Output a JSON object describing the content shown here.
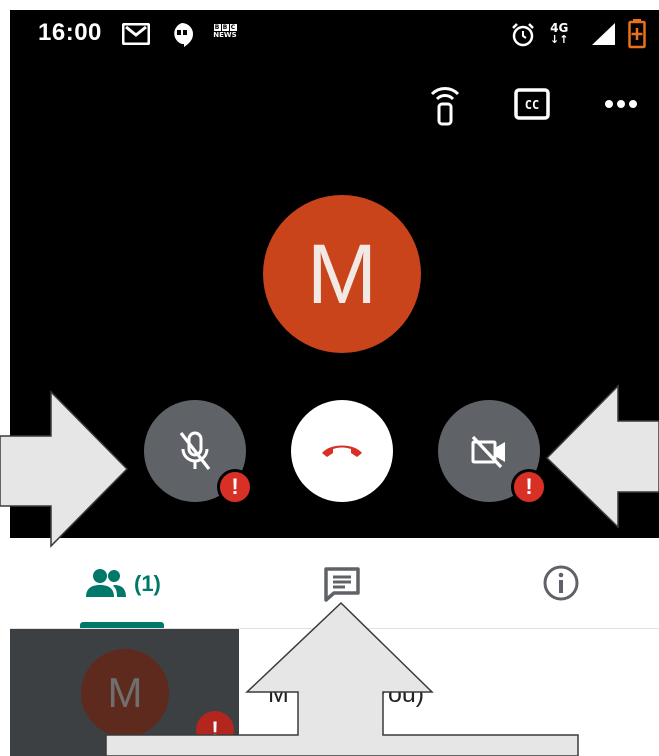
{
  "status_bar": {
    "time": "16:00",
    "network": "4G",
    "icons": [
      "gmail-icon",
      "hangouts-icon",
      "bbc-news-icon",
      "alarm-icon",
      "signal-icon",
      "battery-icon"
    ],
    "bbc_text": "NEWS"
  },
  "call": {
    "top_actions": [
      "cast-icon",
      "captions-icon",
      "more-options-icon"
    ],
    "avatar_initial": "M",
    "avatar_color": "#c9431b",
    "controls": {
      "mic": {
        "icon": "mic-off-icon",
        "badge": "!"
      },
      "end_call": {
        "icon": "end-call-icon",
        "color": "#d93025"
      },
      "camera": {
        "icon": "videocam-off-icon",
        "badge": "!"
      }
    }
  },
  "tabs": {
    "people_count": "(1)",
    "items": [
      "people-tab",
      "chat-tab",
      "info-tab"
    ],
    "accent_color": "#00796b"
  },
  "participant": {
    "initial": "M",
    "badge": "!",
    "name": "M        .ndon (You)"
  }
}
